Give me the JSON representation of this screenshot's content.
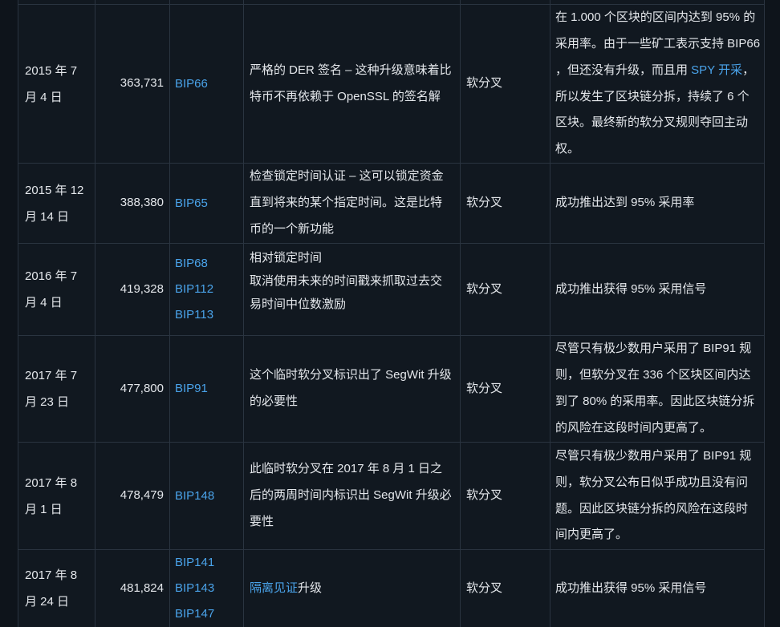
{
  "theme": {
    "page_background": "#0e141b",
    "cell_background": "#111820",
    "border": "#2a3440",
    "text": "#e4e7eb",
    "link": "#4aa3ea"
  },
  "table": {
    "rows": [
      {
        "date": "2015 年 7 月 4 日",
        "block_height": "363,731",
        "bips": [
          "BIP66"
        ],
        "description": [
          "严格的 DER 签名 – 这种升级意味着比",
          "特币不再依赖于 OpenSSL 的签名解"
        ],
        "type": "软分叉",
        "notes": [
          "在 1.000 个区块的区间内达到 95% 的",
          "采用率。由于一些矿工表示支持 BIP66",
          {
            "before": "，但还没有升级，而且用 ",
            "link": "SPY 开采",
            "after": "，"
          },
          "所以发生了区块链分拆，持续了 6 个",
          "区块。最终新的软分叉规则夺回主动",
          "权。"
        ]
      },
      {
        "date": "2015 年 12 月 14 日",
        "block_height": "388,380",
        "bips": [
          "BIP65"
        ],
        "description": [
          "检查锁定时间认证 – 这可以锁定资金",
          "直到将来的某个指定时间。这是比特",
          "币的一个新功能"
        ],
        "type": "软分叉",
        "notes": [
          "成功推出达到 95% 采用率"
        ]
      },
      {
        "date": "2016 年 7 月 4 日",
        "block_height": "419,328",
        "bips": [
          "BIP68",
          "BIP112",
          "BIP113"
        ],
        "description": [
          "相对锁定时间",
          "取消使用未来的时间戳来抓取过去交",
          "易时间中位数激励"
        ],
        "type": "软分叉",
        "notes": [
          "成功推出获得 95% 采用信号"
        ]
      },
      {
        "date": "2017 年 7 月 23 日",
        "block_height": "477,800",
        "bips": [
          "BIP91"
        ],
        "description": [
          "这个临时软分叉标识出了 SegWit 升级",
          "的必要性"
        ],
        "type": "软分叉",
        "notes": [
          "尽管只有极少数用户采用了 BIP91 规",
          "则，但软分叉在 336 个区块区间内达",
          "到了 80% 的采用率。因此区块链分拆",
          "的风险在这段时间内更高了。"
        ]
      },
      {
        "date": "2017 年 8 月 1 日",
        "block_height": "478,479",
        "bips": [
          "BIP148"
        ],
        "description": [
          "此临时软分叉在 2017 年 8 月 1 日之",
          "后的两周时间内标识出 SegWit 升级必",
          "要性"
        ],
        "type": "软分叉",
        "notes": [
          "尽管只有极少数用户采用了 BIP91 规",
          "则，软分叉公布日似乎成功且没有问",
          "题。因此区块链分拆的风险在这段时",
          "间内更高了。"
        ]
      },
      {
        "date": "2017 年 8 月 24 日",
        "block_height": "481,824",
        "bips": [
          "BIP141",
          "BIP143",
          "BIP147"
        ],
        "description": [
          {
            "link": "隔离见证",
            "after": "升级"
          }
        ],
        "type": "软分叉",
        "notes": [
          "成功推出获得 95% 采用信号"
        ]
      }
    ]
  }
}
